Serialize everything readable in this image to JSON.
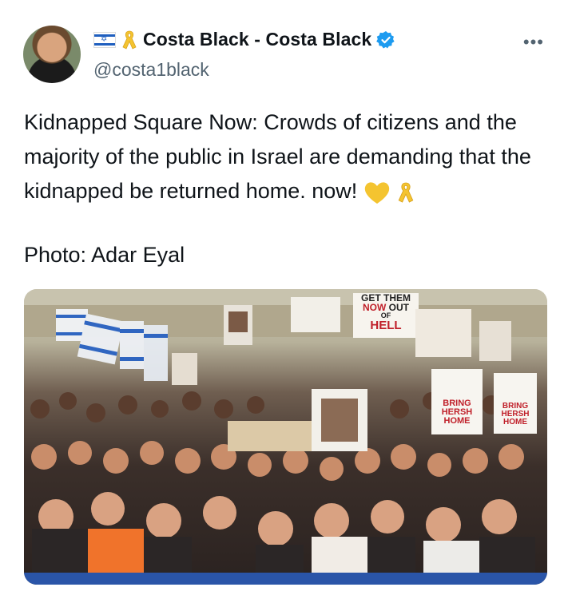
{
  "author": {
    "display_name": "Costa Black - Costa Black",
    "handle": "@costa1black",
    "verified": true
  },
  "icons": {
    "flag": "israel-flag-icon",
    "ribbon": "yellow-ribbon-icon",
    "verified": "verified-badge-icon",
    "more": "more-options-icon",
    "heart": "yellow-heart-icon"
  },
  "post": {
    "text": "Kidnapped Square Now: Crowds of citizens and the majority of the public in Israel are demanding that the kidnapped be returned home. now!",
    "photo_credit": "Photo: Adar Eyal"
  },
  "photo": {
    "signs": [
      "GET THEM",
      "NOW",
      "OUT",
      "OF",
      "HELL",
      "BRING",
      "HERSH",
      "HOME",
      "BRING",
      "HERSH",
      "HOME"
    ]
  },
  "colors": {
    "text": "#0f1419",
    "secondary": "#536471",
    "verified": "#1d9bf0",
    "ribbon": "#f4c430"
  }
}
